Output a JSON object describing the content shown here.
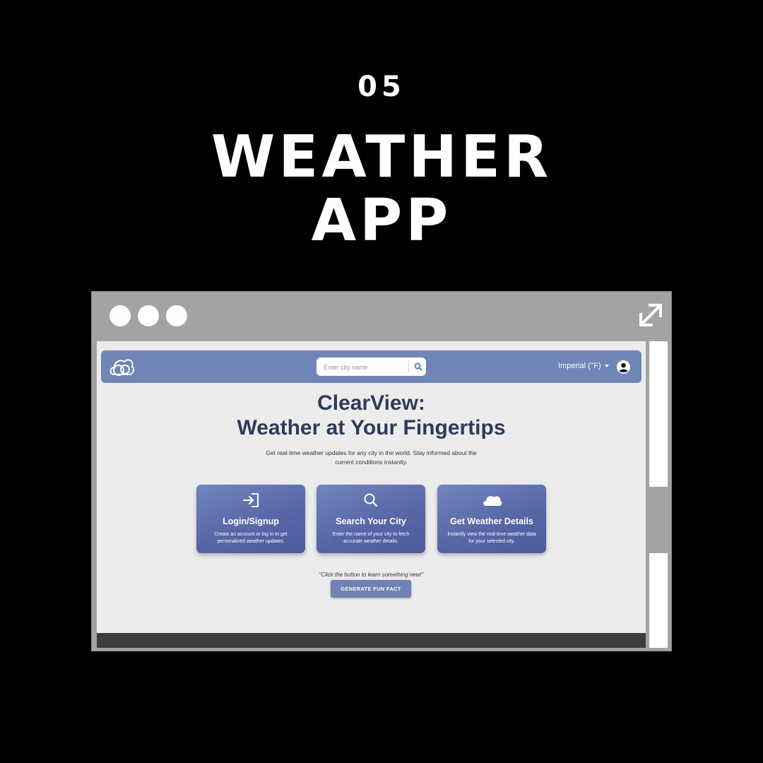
{
  "project": {
    "number": "05",
    "title_line1": "WEATHER",
    "title_line2": "APP"
  },
  "window": {
    "controls": [
      "close-dot",
      "minimize-dot",
      "maximize-dot"
    ],
    "expand_icon": "expand-arrows-icon"
  },
  "navbar": {
    "logo_icon": "cloud-logo-icon",
    "search": {
      "placeholder": "Enter city name",
      "button_icon": "search-icon"
    },
    "units": "Imperial (°F)",
    "account_icon": "user-avatar-icon"
  },
  "hero": {
    "title_line1": "ClearView:",
    "title_line2": "Weather at Your Fingertips",
    "subtitle_line1": "Get real-time weather updates for any city in the world. Stay informed about the",
    "subtitle_line2": "current conditions instantly."
  },
  "features": [
    {
      "icon": "login-icon",
      "title": "Login/Signup",
      "desc": "Create an account or log in to get personalized weather updates."
    },
    {
      "icon": "search-icon",
      "title": "Search Your City",
      "desc": "Enter the name of your city to fetch accurate weather details."
    },
    {
      "icon": "cloud-icon",
      "title": "Get Weather Details",
      "desc": "Instantly view the real-time weather data for your selected city."
    }
  ],
  "fun_fact": {
    "prompt": "\"Click the button to learn something new!\"",
    "button": "GENERATE FUN FACT"
  },
  "colors": {
    "navbar": "#6f86b6",
    "card": "#5867a8",
    "heading": "#2e3b58",
    "page_bg": "#ececec"
  }
}
